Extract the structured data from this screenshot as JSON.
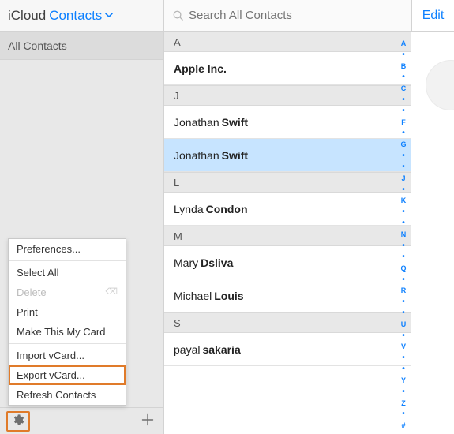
{
  "header": {
    "brand": "iCloud",
    "picker_label": "Contacts"
  },
  "sidebar": {
    "items": [
      {
        "label": "All Contacts"
      }
    ]
  },
  "search": {
    "placeholder": "Search All Contacts"
  },
  "edit_label": "Edit",
  "contacts": {
    "sections": [
      {
        "letter": "A",
        "rows": [
          {
            "display": "Apple Inc.",
            "bold_all": true
          }
        ]
      },
      {
        "letter": "J",
        "rows": [
          {
            "first": "Jonathan",
            "last": "Swift"
          },
          {
            "first": "Jonathan",
            "last": "Swift",
            "selected": true
          }
        ]
      },
      {
        "letter": "L",
        "rows": [
          {
            "first": "Lynda",
            "last": "Condon"
          }
        ]
      },
      {
        "letter": "M",
        "rows": [
          {
            "first": "Mary",
            "last": "Dsliva"
          },
          {
            "first": "Michael",
            "last": "Louis"
          }
        ]
      },
      {
        "letter": "S",
        "rows": [
          {
            "first": "payal",
            "last": "sakaria"
          }
        ]
      }
    ]
  },
  "index_letters": [
    "A",
    "·",
    "B",
    "·",
    "C",
    "·",
    "·",
    "F",
    "·",
    "G",
    "·",
    "·",
    "J",
    "·",
    "K",
    "·",
    "·",
    "N",
    "·",
    "·",
    "Q",
    "·",
    "R",
    "·",
    "·",
    "U",
    "·",
    "V",
    "·",
    "·",
    "Y",
    "·",
    "Z",
    "·",
    "#"
  ],
  "menu": {
    "items": [
      {
        "label": "Preferences...",
        "interactable": true
      },
      {
        "type": "sep"
      },
      {
        "label": "Select All",
        "interactable": true
      },
      {
        "label": "Delete",
        "interactable": false,
        "disabled": true,
        "trailing_glyph": "⌫"
      },
      {
        "label": "Print",
        "interactable": true
      },
      {
        "label": "Make This My Card",
        "interactable": true
      },
      {
        "type": "sep"
      },
      {
        "label": "Import vCard...",
        "interactable": true
      },
      {
        "label": "Export vCard...",
        "interactable": true,
        "highlight": true
      },
      {
        "label": "Refresh Contacts",
        "interactable": true
      }
    ]
  }
}
